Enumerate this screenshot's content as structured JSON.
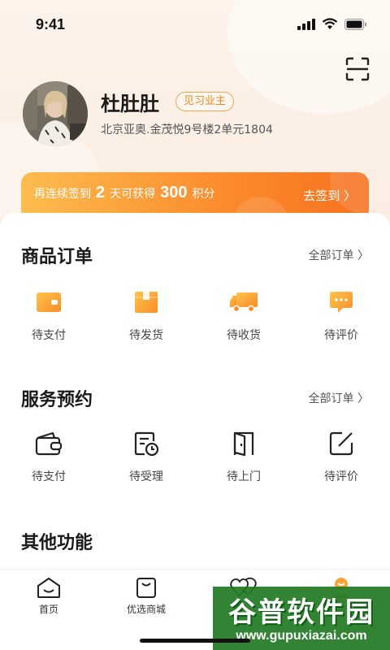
{
  "status_bar": {
    "time": "9:41"
  },
  "profile": {
    "name": "杜肚肚",
    "badge": "见习业主",
    "address": "北京亚奥.金茂悦9号楼2单元1804"
  },
  "sign_in": {
    "prefix": "再连续签到",
    "days": "2",
    "middle": "天可获得",
    "points": "300",
    "suffix": "积分",
    "action": "去签到 〉"
  },
  "product_orders": {
    "title": "商品订单",
    "more": "全部订单 〉",
    "items": [
      {
        "label": "待支付",
        "icon": "wallet-icon"
      },
      {
        "label": "待发货",
        "icon": "package-icon"
      },
      {
        "label": "待收货",
        "icon": "truck-icon"
      },
      {
        "label": "待评价",
        "icon": "comment-icon"
      }
    ]
  },
  "service_booking": {
    "title": "服务预约",
    "more": "全部订单 〉",
    "items": [
      {
        "label": "待支付",
        "icon": "wallet-outline-icon"
      },
      {
        "label": "待受理",
        "icon": "calendar-clock-icon"
      },
      {
        "label": "待上门",
        "icon": "door-icon"
      },
      {
        "label": "待评价",
        "icon": "edit-icon"
      }
    ]
  },
  "other_functions": {
    "title": "其他功能"
  },
  "tab_bar": {
    "items": [
      {
        "label": "首页",
        "icon": "home-icon"
      },
      {
        "label": "优选商城",
        "icon": "shopping-bag-icon"
      },
      {
        "label": "",
        "icon": "heart-icon"
      },
      {
        "label": "",
        "icon": "profile-icon"
      }
    ]
  },
  "watermark": {
    "title": "谷普软件园",
    "url": "www.gupuxiazai.com"
  },
  "colors": {
    "accent": "#fb8a2c",
    "badge": "#e98a1b",
    "watermark": "#227824"
  }
}
